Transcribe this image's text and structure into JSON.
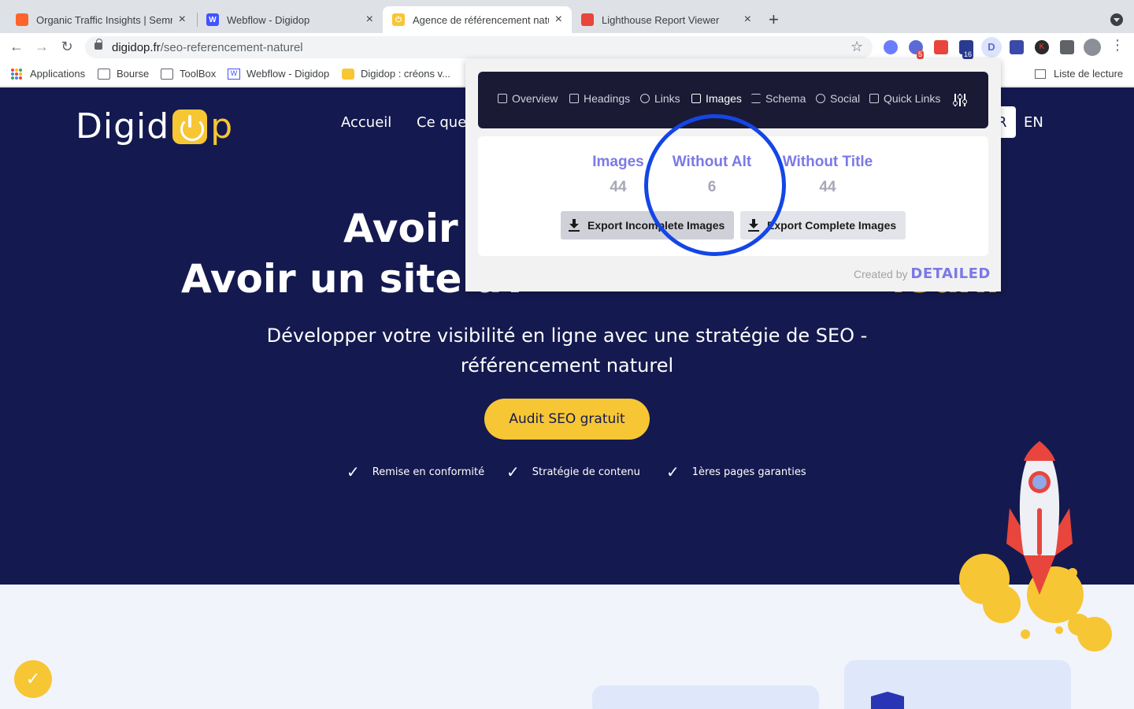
{
  "browser": {
    "tabs": [
      {
        "title": "Organic Traffic Insights | Semrush",
        "active": false,
        "favicon_color": "#ff642d"
      },
      {
        "title": "Webflow - Digidop",
        "active": false,
        "favicon_color": "#4353ff"
      },
      {
        "title": "Agence de référencement naturel",
        "active": true,
        "favicon_color": "#f7c634"
      },
      {
        "title": "Lighthouse Report Viewer",
        "active": false,
        "favicon_color": "#e8453c"
      }
    ],
    "url_domain": "digidop.fr",
    "url_path": "/seo-referencement-naturel",
    "extension_badges": {
      "badge_a": "5",
      "badge_b": "16",
      "letter_d": "D",
      "letter_k": "K"
    },
    "bookmarks": [
      "Applications",
      "Bourse",
      "ToolBox",
      "Webflow - Digidop",
      "Digidop : créons v..."
    ],
    "reading_list": "Liste de lecture"
  },
  "site": {
    "logo_text_a": "Digid",
    "logo_text_b": "p",
    "nav": [
      "Accueil",
      "Ce que"
    ],
    "lang_fr": "R",
    "lang_en": "EN",
    "headline_line1": "Avoir u",
    "headline_line2_a": "Avoir un site av",
    "headline_line2_hl": "ieux.",
    "subtitle": "Développer votre visibilité en ligne avec une stratégie de SEO - référencement naturel",
    "cta": "Audit SEO gratuit",
    "checks": [
      "Remise en conformité",
      "Stratégie de contenu",
      "1ères pages garanties"
    ]
  },
  "popup": {
    "tabs": [
      "Overview",
      "Headings",
      "Links",
      "Images",
      "Schema",
      "Social",
      "Quick Links"
    ],
    "active_tab": "Images",
    "stats": [
      {
        "label": "Images",
        "value": "44"
      },
      {
        "label": "Without Alt",
        "value": "6"
      },
      {
        "label": "Without Title",
        "value": "44"
      }
    ],
    "export_incomplete": "Export Incomplete Images",
    "export_complete": "Export Complete Images",
    "credit_prefix": "Created by",
    "credit_brand": "DETAILED"
  },
  "colors": {
    "hero_bg": "#141a4f",
    "accent_yellow": "#f7c634",
    "popup_accent": "#7b79e6",
    "highlight_ring": "#1446e6"
  }
}
